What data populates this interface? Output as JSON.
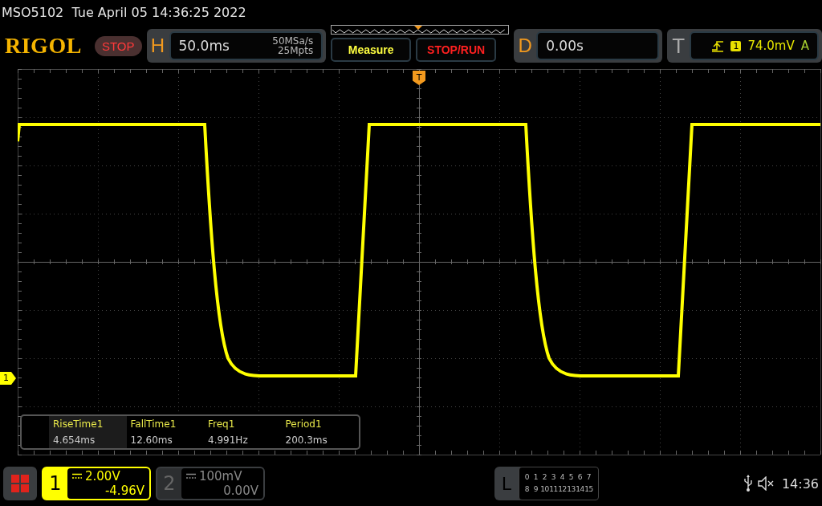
{
  "title": "MSO5102  Tue April 05 14:36:25 2022",
  "toolbar": {
    "logo": "RIGOL",
    "run_state": "STOP",
    "horizontal": {
      "label": "H",
      "timebase": "50.0ms",
      "sample_rate": "50MSa/s",
      "memory_depth": "25Mpts"
    },
    "buttons": [
      {
        "label": "Measure",
        "kind": "menu"
      },
      {
        "label": "STOP/RUN",
        "kind": "run"
      }
    ],
    "delay": {
      "label": "D",
      "value": "0.00s"
    },
    "trigger": {
      "label": "T",
      "source": "1",
      "level": "74.0mV",
      "mode": "A"
    }
  },
  "plot": {
    "trigger_marker": "T",
    "channel_marker": "1",
    "measurements": [
      {
        "name": "RiseTime1",
        "value": "4.654ms",
        "selected": true
      },
      {
        "name": "FallTime1",
        "value": "12.60ms",
        "selected": false
      },
      {
        "name": "Freq1",
        "value": "4.991Hz",
        "selected": false
      },
      {
        "name": "Period1",
        "value": "200.3ms",
        "selected": false
      }
    ]
  },
  "channels": [
    {
      "number": "1",
      "scale": "2.00V",
      "offset": "-4.96V",
      "selected": true
    },
    {
      "number": "2",
      "scale": "100mV",
      "offset": "0.00V",
      "selected": false
    }
  ],
  "logic": {
    "label": "L",
    "rows": [
      [
        "0",
        "1",
        "2",
        "3",
        "4",
        "5",
        "6",
        "7"
      ],
      [
        "8",
        "9",
        "10",
        "11",
        "12",
        "13",
        "14",
        "15"
      ]
    ]
  },
  "status": {
    "time": "14:36"
  }
}
